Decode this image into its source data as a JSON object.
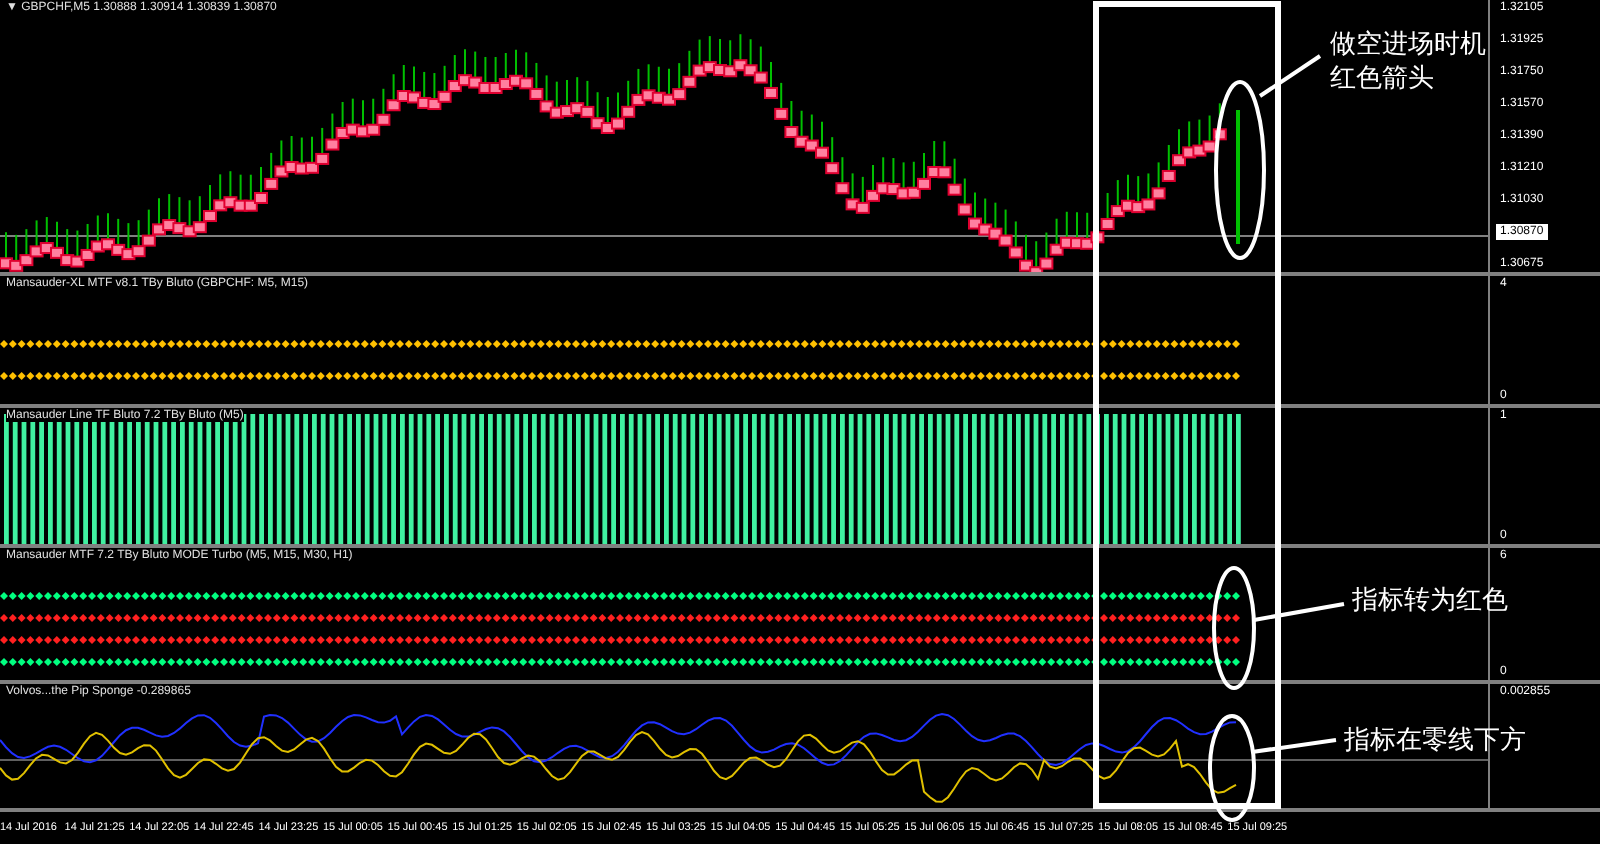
{
  "header": {
    "marker": "▼",
    "symbol": "GBPCHF,M5",
    "quotes": "1.30888 1.30914 1.30839 1.30870"
  },
  "price_axis": [
    {
      "label": "1.32105",
      "current": false
    },
    {
      "label": "1.31925",
      "current": false
    },
    {
      "label": "1.31750",
      "current": false
    },
    {
      "label": "1.31570",
      "current": false
    },
    {
      "label": "1.31390",
      "current": false
    },
    {
      "label": "1.31210",
      "current": false
    },
    {
      "label": "1.31030",
      "current": false
    },
    {
      "label": "1.30870",
      "current": true
    },
    {
      "label": "1.30675",
      "current": false
    }
  ],
  "indicators": [
    {
      "kind": "dots",
      "title": "Mansauder-XL MTF v8.1  TBy Bluto (GBPCHF: M5, M15)",
      "scale": [
        "4",
        "0"
      ],
      "rows": [
        {
          "color": "#ffc000"
        },
        {
          "color": "#ffc000"
        }
      ]
    },
    {
      "kind": "histogram",
      "title": "Mansauder Line TF Bluto 7.2 TBy Bluto (M5)",
      "scale": [
        "1",
        "0"
      ]
    },
    {
      "kind": "dots",
      "title": "Mansauder MTF 7.2  TBy Bluto  MODE Turbo  (M5, M15, M30, H1)",
      "scale": [
        "6",
        "0"
      ],
      "rows": [
        {
          "color": "#00ff80"
        },
        {
          "color": "#ff2020"
        },
        {
          "color": "#ff2020"
        },
        {
          "color": "#00ff80"
        }
      ]
    },
    {
      "kind": "oscillator",
      "title": "Volvos...the Pip Sponge -0.289865",
      "scale": [
        "0.002855"
      ]
    }
  ],
  "time_axis": [
    "14 Jul 2016",
    "14 Jul 21:25",
    "14 Jul 22:05",
    "14 Jul 22:45",
    "14 Jul 23:25",
    "15 Jul 00:05",
    "15 Jul 00:45",
    "15 Jul 01:25",
    "15 Jul 02:05",
    "15 Jul 02:45",
    "15 Jul 03:25",
    "15 Jul 04:05",
    "15 Jul 04:45",
    "15 Jul 05:25",
    "15 Jul 06:05",
    "15 Jul 06:45",
    "15 Jul 07:25",
    "15 Jul 08:05",
    "15 Jul 08:45",
    "15 Jul 09:25"
  ],
  "annotations": [
    {
      "lines": [
        "做空进场时机",
        "红色箭头"
      ]
    },
    {
      "lines": [
        "指标转为红色"
      ]
    },
    {
      "lines": [
        "指标在零线下方"
      ]
    }
  ]
}
